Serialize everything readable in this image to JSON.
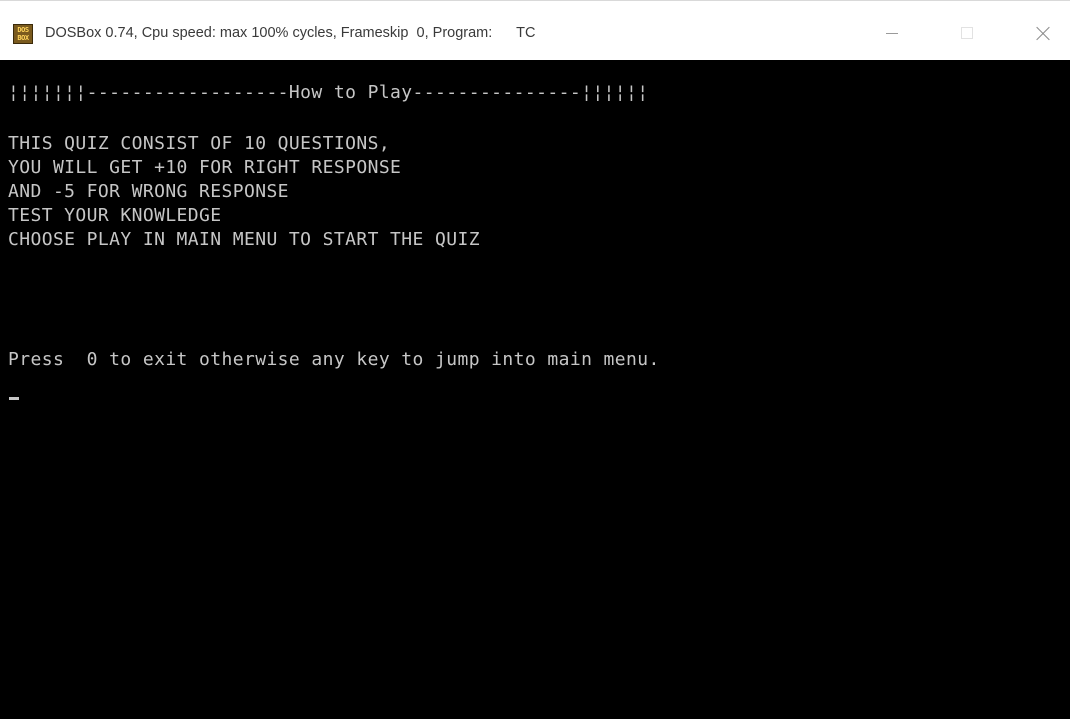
{
  "window": {
    "title": "DOSBox 0.74, Cpu speed: max 100% cycles, Frameskip  0, Program:      TC",
    "icon": "dosbox-icon",
    "icon_text": [
      "DOS",
      "BOX"
    ],
    "controls": [
      "minimize",
      "maximize",
      "close"
    ]
  },
  "screen": {
    "header": "¦¦¦¦¦¦¦------------------How to Play---------------¦¦¦¦¦¦",
    "instructions": [
      "THIS QUIZ CONSIST OF 10 QUESTIONS,",
      "YOU WILL GET +10 FOR RIGHT RESPONSE",
      "AND -5 FOR WRONG RESPONSE",
      "TEST YOUR KNOWLEDGE",
      "CHOOSE PLAY IN MAIN MENU TO START THE QUIZ"
    ],
    "prompt": "Press  0 to exit otherwise any key to jump into main menu.",
    "cursor": "_"
  },
  "colors": {
    "screen_bg": "#000000",
    "text": "#c6c6c6",
    "titlebar_bg": "#ffffff"
  }
}
